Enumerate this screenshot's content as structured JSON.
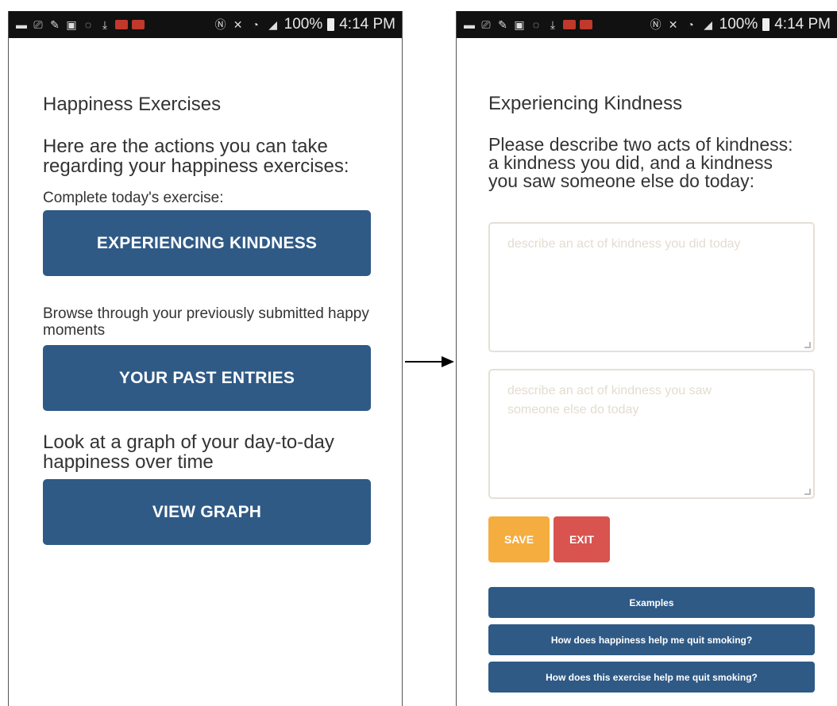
{
  "status_bar": {
    "battery": "100%",
    "time": "4:14 PM",
    "icons": [
      "message-icon",
      "cast-icon",
      "wrench-icon",
      "save-icon",
      "wifi-icon",
      "download-icon",
      "mail-icon",
      "mail-icon",
      "nfc-icon",
      "mute-icon",
      "wifi-signal-icon",
      "cell-signal-icon",
      "battery-icon"
    ]
  },
  "left_screen": {
    "title": "Happiness Exercises",
    "intro": "Here are the actions you can take regarding your happiness exercises:",
    "today_label": "Complete today's exercise:",
    "today_button": "EXPERIENCING KINDNESS",
    "browse_label": "Browse through your previously submitted happy moments",
    "past_button": "YOUR PAST ENTRIES",
    "graph_label": "Look at a graph of your day-to-day happiness over time",
    "graph_button": "VIEW GRAPH"
  },
  "right_screen": {
    "title": "Experiencing Kindness",
    "prompt": "Please describe two acts of kindness: a kindness you did, and a kindness you saw someone else do today:",
    "field1_placeholder": "describe an act of kindness you did today",
    "field2_placeholder": "describe an act of kindness you saw someone else do today",
    "save_label": "SAVE",
    "exit_label": "EXIT",
    "examples_label": "Examples",
    "help1_label": "How does happiness help me quit smoking?",
    "help2_label": "How does this exercise help me quit smoking?"
  },
  "colors": {
    "primary_button": "#2f5a86",
    "save_button": "#f5ad3f",
    "exit_button": "#d9534f",
    "status_bar": "#111111"
  }
}
